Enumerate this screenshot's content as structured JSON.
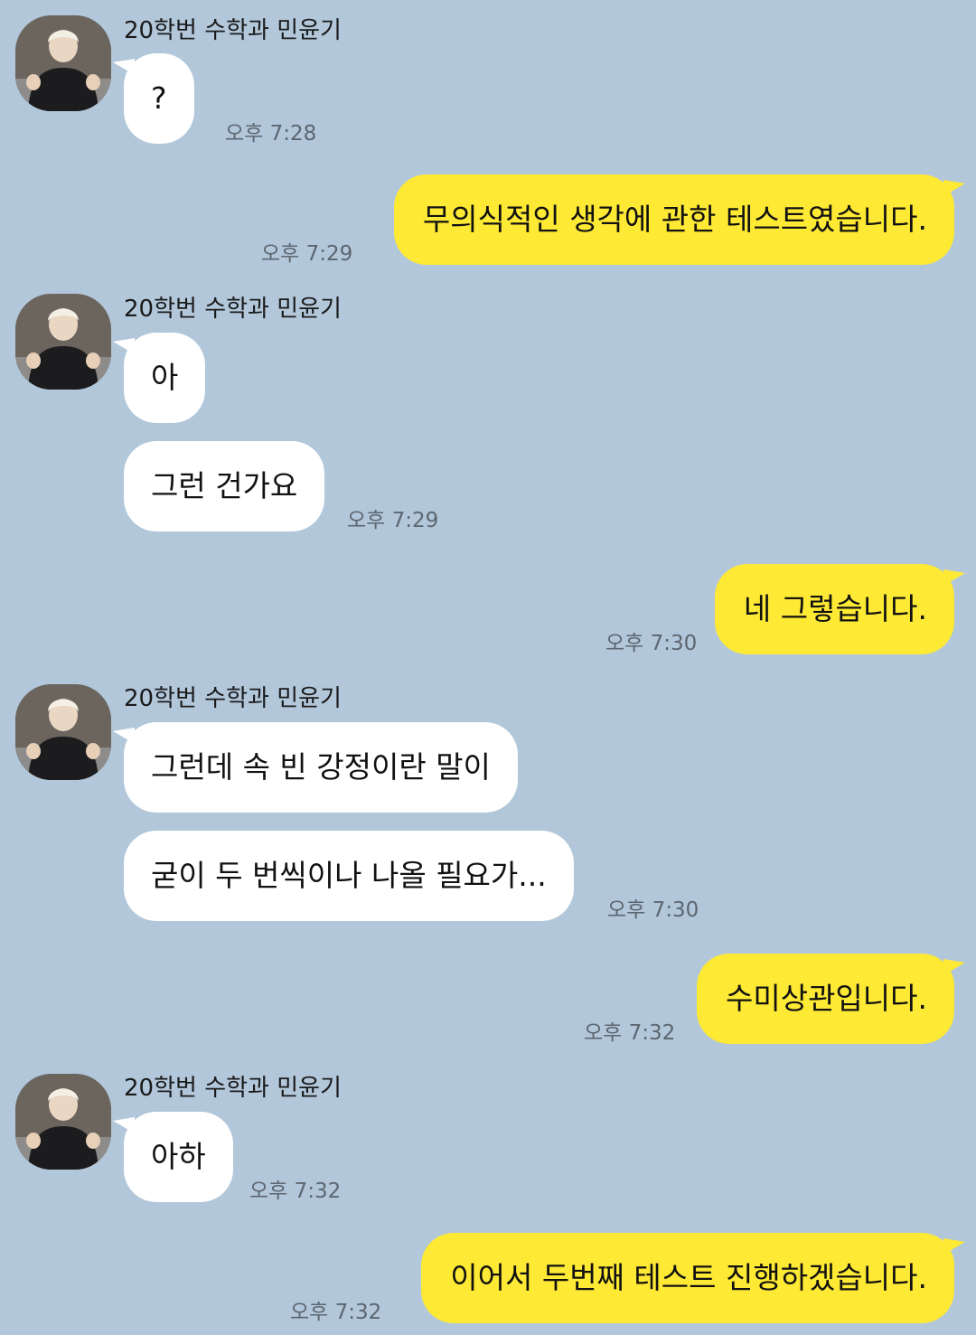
{
  "colors": {
    "background": "#b2c7da",
    "incoming_bubble": "#ffffff",
    "outgoing_bubble": "#fee934",
    "timestamp": "#5c6670"
  },
  "contact": {
    "name": "20학번 수학과 민윤기",
    "avatar": "profile-photo"
  },
  "messages": [
    {
      "sender": "20학번 수학과 민윤기",
      "text": "?",
      "time": "오후 7:28"
    },
    {
      "text": "무의식적인 생각에 관한 테스트였습니다.",
      "time": "오후 7:29"
    },
    {
      "sender": "20학번 수학과 민윤기",
      "text": "아"
    },
    {
      "text": "그런 건가요",
      "time": "오후 7:29"
    },
    {
      "text": "네 그렇습니다.",
      "time": "오후 7:30"
    },
    {
      "sender": "20학번 수학과 민윤기",
      "text": "그런데 속 빈 강정이란 말이"
    },
    {
      "text": "굳이 두 번씩이나 나올 필요가...",
      "time": "오후 7:30"
    },
    {
      "text": "수미상관입니다.",
      "time": "오후 7:32"
    },
    {
      "sender": "20학번 수학과 민윤기",
      "text": "아하",
      "time": "오후 7:32"
    },
    {
      "text": "이어서 두번째 테스트 진행하겠습니다.",
      "time": "오후 7:32"
    }
  ]
}
